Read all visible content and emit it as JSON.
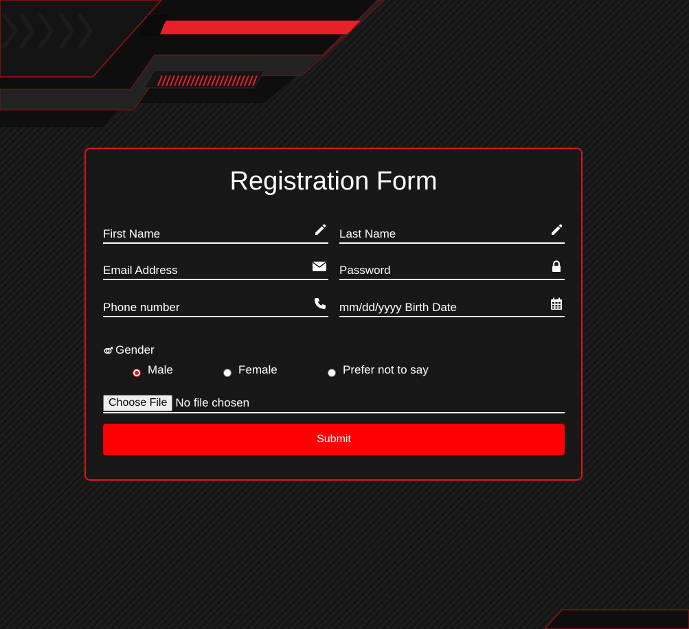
{
  "form": {
    "title": "Registration Form",
    "fields": {
      "first_name": "First Name",
      "last_name": "Last Name",
      "email": "Email Address",
      "password": "Password",
      "phone": "Phone number",
      "birth_date": "mm/dd/yyyy Birth Date"
    },
    "gender": {
      "label": "Gender",
      "options": [
        "Male",
        "Female",
        "Prefer not to say"
      ],
      "selected": "Male"
    },
    "file": {
      "button_label": "Choose File",
      "status": "No file chosen"
    },
    "submit_label": "Submit"
  },
  "icons": {
    "first_name": "pencil-icon",
    "last_name": "pencil-icon",
    "email": "envelope-icon",
    "password": "lock-icon",
    "phone": "phone-icon",
    "birth_date": "calendar-icon",
    "gender": "gender-icon"
  },
  "colors": {
    "accent": "#ff0000",
    "border": "#e0141b",
    "card": "#181818",
    "text": "#ffffff"
  }
}
